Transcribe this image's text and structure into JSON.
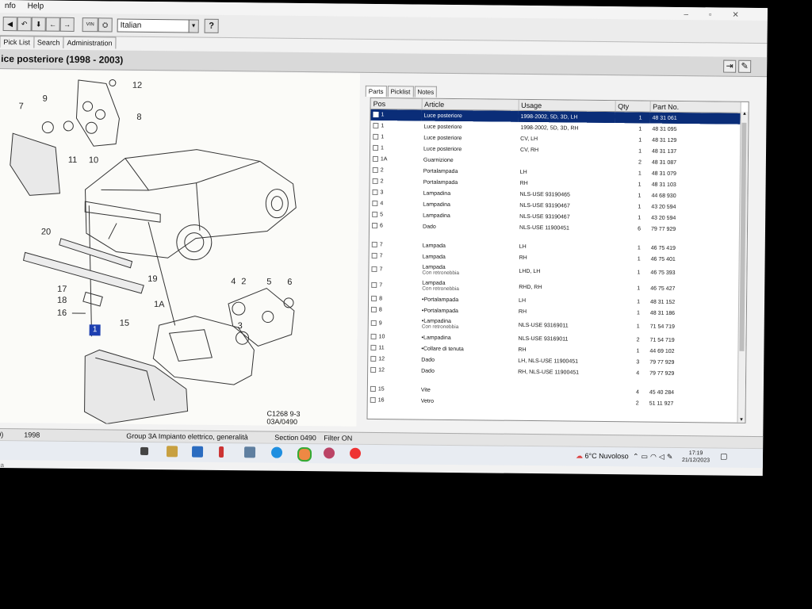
{
  "menubar": {
    "items": [
      "nfo",
      "Help"
    ]
  },
  "toolbar": {
    "buttons": [
      "◀",
      "↶",
      "⬇",
      "←",
      "→",
      "VIN",
      "⛭"
    ],
    "language": "Italian",
    "help": "?"
  },
  "top_tabs": [
    "Pick List",
    "Search",
    "Administration"
  ],
  "page": {
    "title": "ice posteriore   (1998 - 2003)"
  },
  "diagram": {
    "labels": [
      "7",
      "9",
      "12",
      "8",
      "11",
      "10",
      "20",
      "19",
      "17",
      "18",
      "16",
      "15",
      "4",
      "2",
      "5",
      "6",
      "3",
      "1A"
    ],
    "callout": "1",
    "figure_code_1": "C1268 9-3",
    "figure_code_2": "03A/0490"
  },
  "right_tabs": [
    "Parts",
    "Picklist",
    "Notes"
  ],
  "table": {
    "columns": [
      "Pos",
      "Article",
      "Usage",
      "Qty",
      "Part No."
    ],
    "rows": [
      {
        "pos": "1",
        "article": "Luce posteriore",
        "sub": "",
        "usage": "1998-2002, 5D, 3D, LH",
        "qty": "1",
        "part": "48 31 061",
        "selected": true
      },
      {
        "pos": "1",
        "article": "Luce posteriore",
        "sub": "",
        "usage": "1998-2002, 5D, 3D, RH",
        "qty": "1",
        "part": "48 31 095"
      },
      {
        "pos": "1",
        "article": "Luce posteriore",
        "sub": "",
        "usage": "CV, LH",
        "qty": "1",
        "part": "48 31 129"
      },
      {
        "pos": "1",
        "article": "Luce posteriore",
        "sub": "",
        "usage": "CV, RH",
        "qty": "1",
        "part": "48 31 137"
      },
      {
        "pos": "1A",
        "article": "Guarnizione",
        "sub": "",
        "usage": "",
        "qty": "2",
        "part": "48 31 087"
      },
      {
        "pos": "2",
        "article": "Portalampada",
        "sub": "",
        "usage": "LH",
        "qty": "1",
        "part": "48 31 079"
      },
      {
        "pos": "2",
        "article": "Portalampada",
        "sub": "",
        "usage": "RH",
        "qty": "1",
        "part": "48 31 103"
      },
      {
        "pos": "3",
        "article": "Lampadina",
        "sub": "",
        "usage": "NLS-USE 93190465",
        "qty": "1",
        "part": "44 68 930"
      },
      {
        "pos": "4",
        "article": "Lampadina",
        "sub": "",
        "usage": "NLS-USE 93190467",
        "qty": "1",
        "part": "43 20 594"
      },
      {
        "pos": "5",
        "article": "Lampadina",
        "sub": "",
        "usage": "NLS-USE 93190467",
        "qty": "1",
        "part": "43 20 594"
      },
      {
        "pos": "6",
        "article": "Dado",
        "sub": "",
        "usage": "NLS-USE 11900451",
        "qty": "6",
        "part": "79 77 929"
      },
      {
        "blank": true
      },
      {
        "pos": "7",
        "article": "Lampada",
        "sub": "",
        "usage": "LH",
        "qty": "1",
        "part": "46 75 419"
      },
      {
        "pos": "7",
        "article": "Lampada",
        "sub": "",
        "usage": "RH",
        "qty": "1",
        "part": "46 75 401"
      },
      {
        "pos": "7",
        "article": "Lampada",
        "sub": "Con retronebbia",
        "usage": "LHD, LH",
        "qty": "1",
        "part": "46 75 393"
      },
      {
        "pos": "7",
        "article": "Lampada",
        "sub": "Con retronebbia",
        "usage": "RHD, RH",
        "qty": "1",
        "part": "46 75 427"
      },
      {
        "pos": "8",
        "article": "•Portalampada",
        "sub": "",
        "usage": "LH",
        "qty": "1",
        "part": "48 31 152"
      },
      {
        "pos": "8",
        "article": "•Portalampada",
        "sub": "",
        "usage": "RH",
        "qty": "1",
        "part": "48 31 186"
      },
      {
        "pos": "9",
        "article": "•Lampadina",
        "sub": "Con retronebbia",
        "usage": "NLS-USE 93169011",
        "qty": "1",
        "part": "71 54 719"
      },
      {
        "pos": "10",
        "article": "•Lampadina",
        "sub": "",
        "usage": "NLS-USE 93169011",
        "qty": "2",
        "part": "71 54 719"
      },
      {
        "pos": "11",
        "article": "•Collare di tenuta",
        "sub": "",
        "usage": "RH",
        "qty": "1",
        "part": "44 69 102"
      },
      {
        "pos": "12",
        "article": "Dado",
        "sub": "",
        "usage": "LH, NLS-USE 11900451",
        "qty": "3",
        "part": "79 77 929"
      },
      {
        "pos": "12",
        "article": "Dado",
        "sub": "",
        "usage": "RH, NLS-USE 11900451",
        "qty": "4",
        "part": "79 77 929"
      },
      {
        "blank": true
      },
      {
        "pos": "15",
        "article": "Vite",
        "sub": "",
        "usage": "",
        "qty": "4",
        "part": "45 40 284"
      },
      {
        "pos": "16",
        "article": "Vetro",
        "sub": "",
        "usage": "",
        "qty": "2",
        "part": "51 11 927"
      }
    ]
  },
  "status": {
    "col1": "9)",
    "year": "1998",
    "group": "Group  3A Impianto elettrico, generalità",
    "section": "Section  0490",
    "filter": "Filter  ON"
  },
  "taskbar": {
    "weather": "6°C  Nuvoloso",
    "time": "17:19",
    "date": "21/12/2023"
  },
  "left_strip": "rca"
}
